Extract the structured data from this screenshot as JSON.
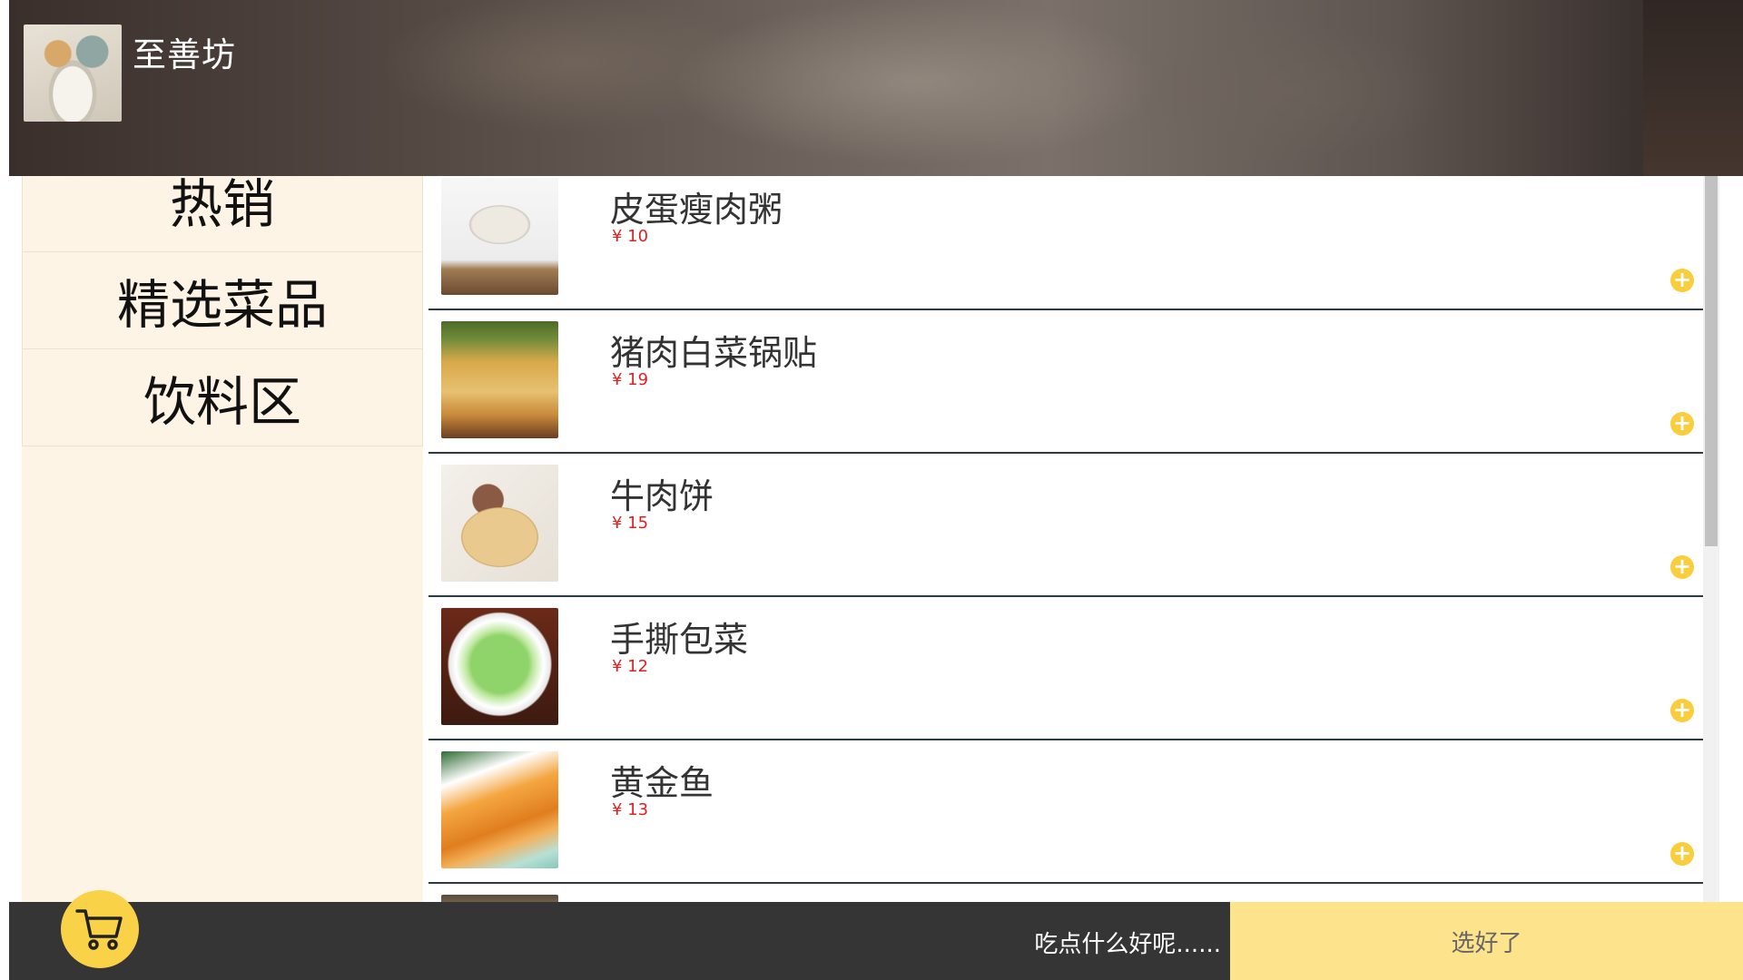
{
  "header": {
    "shop_name": "至善坊",
    "logo_icon": "shop-logo-image"
  },
  "sidebar": {
    "categories": [
      {
        "label": "热销"
      },
      {
        "label": "精选菜品"
      },
      {
        "label": "饮料区"
      }
    ]
  },
  "dishes": [
    {
      "name": "皮蛋瘦肉粥",
      "price": "¥ 10",
      "image": "congee-image"
    },
    {
      "name": "猪肉白菜锅贴",
      "price": "¥ 19",
      "image": "potsticker-image"
    },
    {
      "name": "牛肉饼",
      "price": "¥ 15",
      "image": "beef-pie-image"
    },
    {
      "name": "手撕包菜",
      "price": "¥ 12",
      "image": "cabbage-image"
    },
    {
      "name": "黄金鱼",
      "price": "¥ 13",
      "image": "golden-fish-image"
    }
  ],
  "add_icon": "plus-circle-icon",
  "footer": {
    "cart_icon": "shopping-cart-icon",
    "hint": "吃点什么好呢......",
    "confirm_label": "选好了"
  },
  "colors": {
    "accent_yellow": "#f9d247",
    "price_red": "#e02020",
    "sidebar_bg": "#fdf4e5",
    "footer_bg": "#353535",
    "confirm_bg": "#fde48c"
  }
}
